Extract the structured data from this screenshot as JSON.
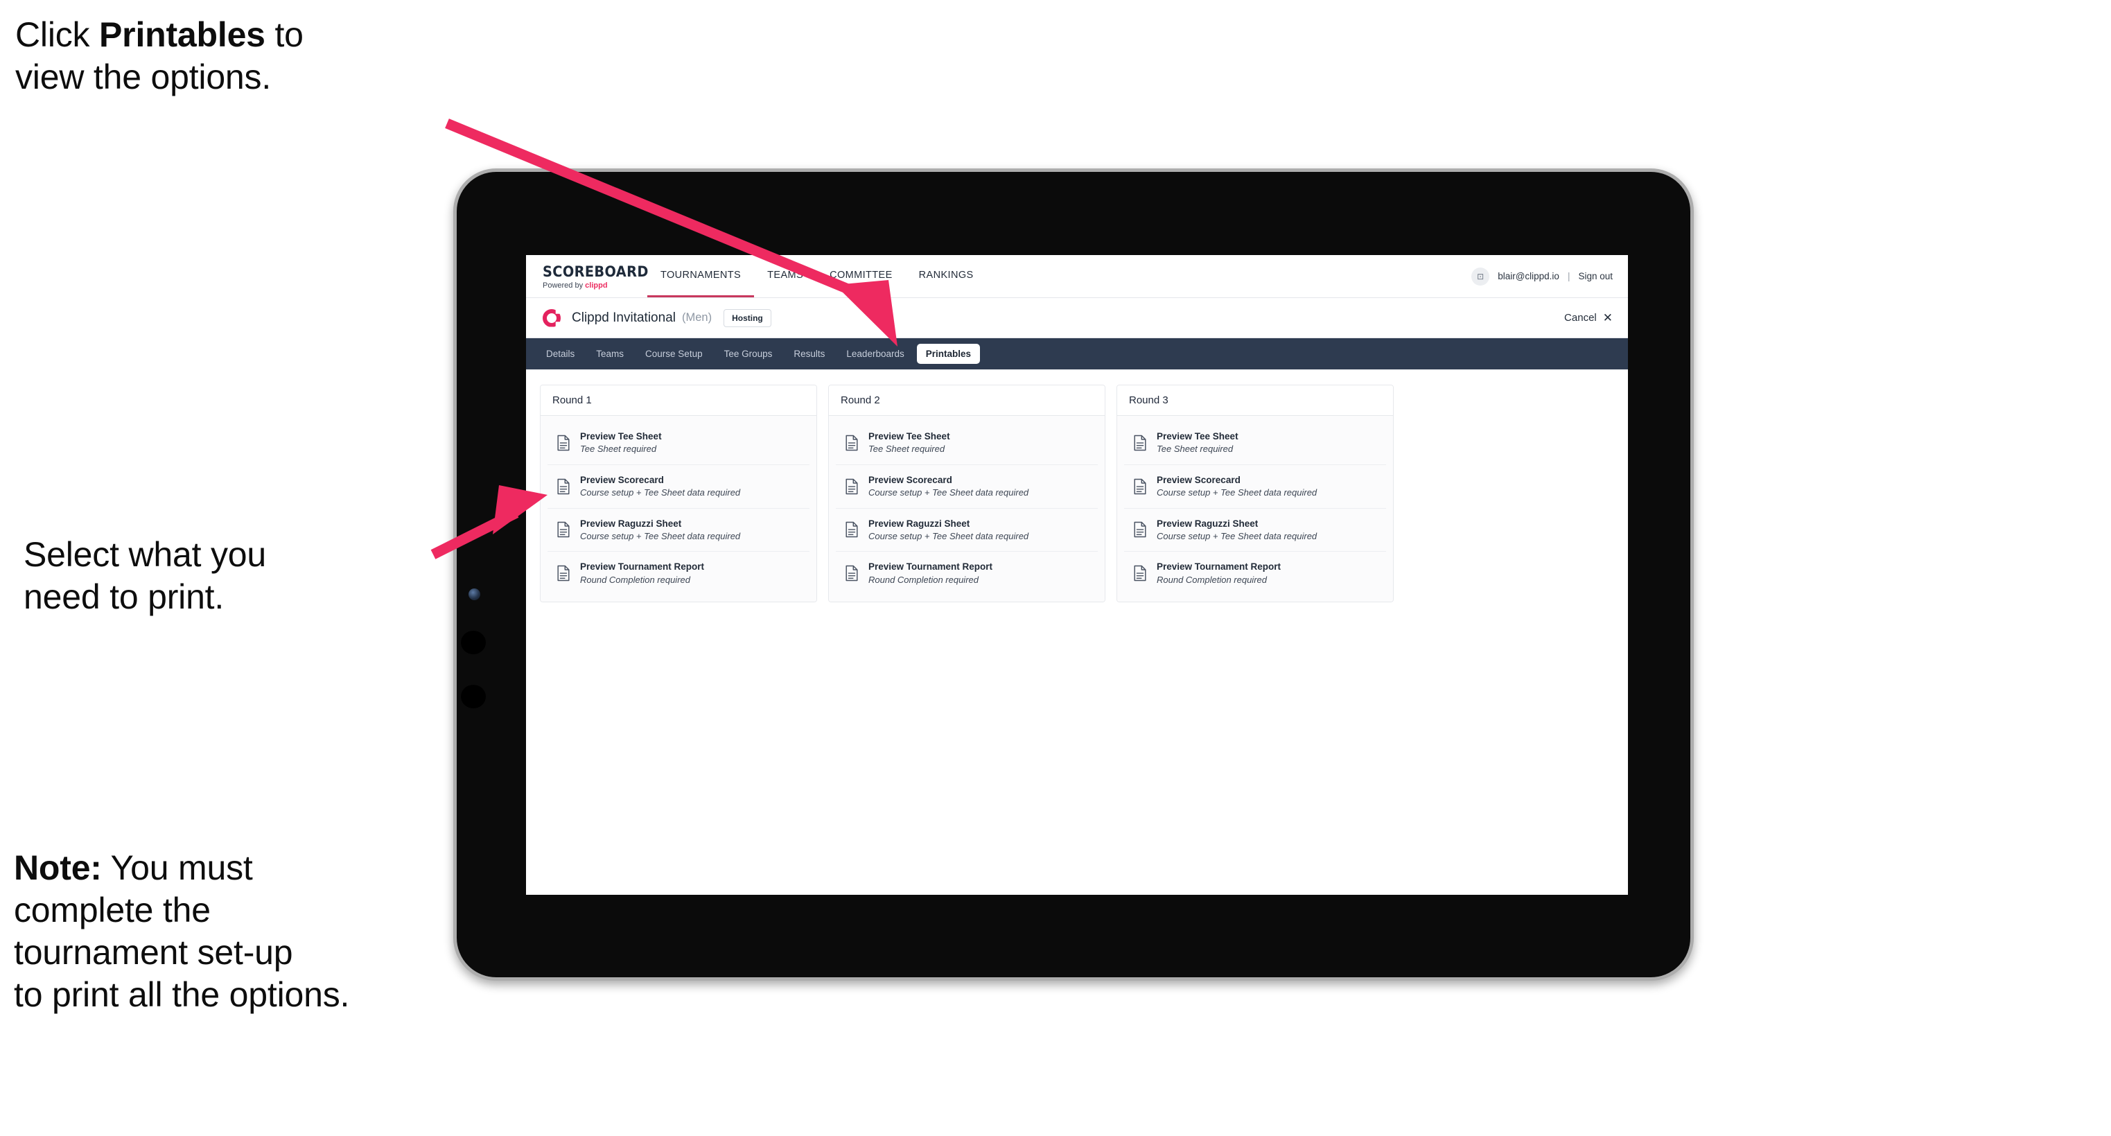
{
  "annotations": {
    "top": {
      "prefix": "Click ",
      "bold": "Printables",
      "suffix": " to\nview the options."
    },
    "middle": {
      "text": "Select what you\n  need to print."
    },
    "note": {
      "bold": "Note:",
      "text": " You must\ncomplete the\ntournament set-up\nto print all the options."
    }
  },
  "colors": {
    "arrow_pink": "#ee2a60",
    "brand_pink": "#ec2f62",
    "tabstrip_navy": "#2e3b50",
    "accent_underline": "#c8375d"
  },
  "browser": {
    "topbar": {
      "brand": {
        "title": "SCOREBOARD",
        "powered_prefix": "Powered by ",
        "powered_brand": "clippd"
      },
      "nav_items": [
        {
          "label": "TOURNAMENTS",
          "active": true
        },
        {
          "label": "TEAMS",
          "active": false
        },
        {
          "label": "COMMITTEE",
          "active": false
        },
        {
          "label": "RANKINGS",
          "active": false
        }
      ],
      "account": {
        "avatar_glyph": "⊡",
        "email": "blair@clippd.io",
        "separator": "|",
        "sign_out": "Sign out"
      }
    },
    "tournament_bar": {
      "logo_letter": "C",
      "name": "Clippd Invitational",
      "gender": "(Men)",
      "badge": "Hosting",
      "cancel_label": "Cancel",
      "cancel_icon": "✕"
    },
    "tabs": [
      {
        "label": "Details",
        "active": false
      },
      {
        "label": "Teams",
        "active": false
      },
      {
        "label": "Course Setup",
        "active": false
      },
      {
        "label": "Tee Groups",
        "active": false
      },
      {
        "label": "Results",
        "active": false
      },
      {
        "label": "Leaderboards",
        "active": false
      },
      {
        "label": "Printables",
        "active": true
      }
    ],
    "rounds": [
      {
        "title": "Round 1",
        "items": [
          {
            "title": "Preview Tee Sheet",
            "subtitle": "Tee Sheet required"
          },
          {
            "title": "Preview Scorecard",
            "subtitle": "Course setup + Tee Sheet data required"
          },
          {
            "title": "Preview Raguzzi Sheet",
            "subtitle": "Course setup + Tee Sheet data required"
          },
          {
            "title": "Preview Tournament Report",
            "subtitle": "Round Completion required"
          }
        ]
      },
      {
        "title": "Round 2",
        "items": [
          {
            "title": "Preview Tee Sheet",
            "subtitle": "Tee Sheet required"
          },
          {
            "title": "Preview Scorecard",
            "subtitle": "Course setup + Tee Sheet data required"
          },
          {
            "title": "Preview Raguzzi Sheet",
            "subtitle": "Course setup + Tee Sheet data required"
          },
          {
            "title": "Preview Tournament Report",
            "subtitle": "Round Completion required"
          }
        ]
      },
      {
        "title": "Round 3",
        "items": [
          {
            "title": "Preview Tee Sheet",
            "subtitle": "Tee Sheet required"
          },
          {
            "title": "Preview Scorecard",
            "subtitle": "Course setup + Tee Sheet data required"
          },
          {
            "title": "Preview Raguzzi Sheet",
            "subtitle": "Course setup + Tee Sheet data required"
          },
          {
            "title": "Preview Tournament Report",
            "subtitle": "Round Completion required"
          }
        ]
      }
    ]
  }
}
